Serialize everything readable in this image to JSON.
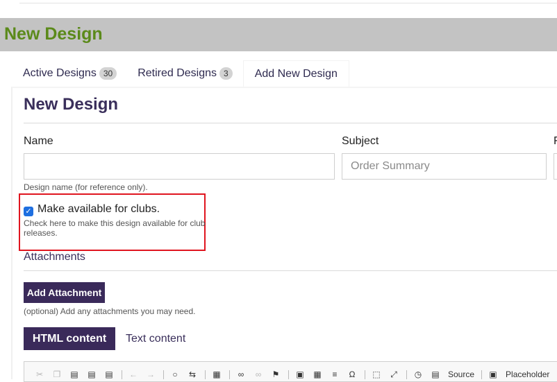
{
  "page": {
    "title": "New Design"
  },
  "tabs": [
    {
      "label": "Active Designs",
      "count": "30"
    },
    {
      "label": "Retired Designs",
      "count": "3"
    },
    {
      "label": "Add New Design"
    }
  ],
  "form": {
    "section_title": "New Design",
    "name": {
      "label": "Name",
      "value": "",
      "help": "Design name (for reference only)."
    },
    "subject": {
      "label": "Subject",
      "placeholder": "Order Summary"
    },
    "third_label": "F",
    "clubs": {
      "checked": true,
      "label": "Make available for clubs.",
      "help": "Check here to make this design available for club releases."
    },
    "attachments": {
      "title": "Attachments",
      "add_button": "Add Attachment",
      "help": "(optional) Add any attachments you may need."
    },
    "content_tabs": {
      "html": "HTML content",
      "text": "Text content"
    }
  },
  "editor_toolbar": {
    "icons": [
      "cut-icon",
      "copy-icon",
      "paste-icon",
      "paste-text-icon",
      "paste-word-icon",
      "undo-icon",
      "redo-icon",
      "find-icon",
      "replace-icon",
      "select-all-icon",
      "link-icon",
      "unlink-icon",
      "anchor-icon",
      "image-icon",
      "table-icon",
      "horizontal-rule-icon",
      "special-char-icon",
      "show-blocks-icon",
      "maximize-icon",
      "templates-icon"
    ],
    "source_label": "Source",
    "placeholder_label": "Placeholder"
  }
}
